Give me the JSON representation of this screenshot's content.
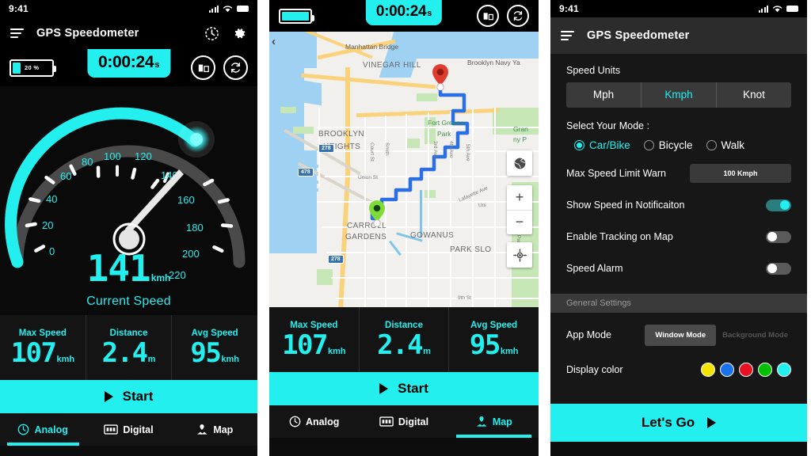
{
  "app": {
    "title": "GPS Speedometer",
    "accent": "#24efef",
    "background": "#0d0d0d"
  },
  "status_bar": {
    "time": "9:41"
  },
  "panel1": {
    "icons": {
      "menu": "hamburger-icon",
      "history": "history-clock-icon",
      "settings": "gear-icon"
    },
    "battery": {
      "percent": "20 %"
    },
    "timer": {
      "value": "0:00:24",
      "unit": "s"
    },
    "actions": {
      "split": "split-screen-icon",
      "reset": "refresh-icon"
    },
    "gauge": {
      "current_speed": "141",
      "unit": "kmh",
      "caption": "Current Speed",
      "ticks": [
        "0",
        "20",
        "40",
        "60",
        "80",
        "100",
        "120",
        "140",
        "160",
        "180",
        "200",
        "220"
      ]
    },
    "stats": [
      {
        "label": "Max Speed",
        "value": "107",
        "unit": "kmh"
      },
      {
        "label": "Distance",
        "value": "2.4",
        "unit": "m"
      },
      {
        "label": "Avg Speed",
        "value": "95",
        "unit": "kmh"
      }
    ],
    "start_button": "Start",
    "nav": [
      {
        "label": "Analog",
        "icon": "speedometer-icon",
        "active": true
      },
      {
        "label": "Digital",
        "icon": "digital-display-icon",
        "active": false
      },
      {
        "label": "Map",
        "icon": "map-pin-icon",
        "active": false
      }
    ]
  },
  "panel2": {
    "timer": {
      "value": "0:00:24",
      "unit": "s"
    },
    "actions": {
      "split": "split-screen-icon",
      "reset": "refresh-icon"
    },
    "map": {
      "labels": [
        "Manhattan Bridge",
        "VINEGAR HILL",
        "Brooklyn Navy Ya",
        "Fort Greene",
        "Park",
        "BROOKLYN",
        "HEIGHTS",
        "CARROLL",
        "GARDENS",
        "GOWANUS",
        "PARK SLO",
        "Union St",
        "Court St",
        "Smith",
        "3rd Ave",
        "4th Ave",
        "5th Ave",
        "9th St",
        "Lafayette Ave",
        "Gran",
        "ny P",
        "Uni",
        "ct Park West"
      ],
      "shields": [
        "278",
        "478",
        "278"
      ],
      "controls": {
        "globe": "globe-icon",
        "zoom_in": "+",
        "zoom_out": "−",
        "locate": "locate-crosshair-icon"
      },
      "markers": {
        "start": "green-pin",
        "end": "red-pin"
      }
    },
    "stats": [
      {
        "label": "Max Speed",
        "value": "107",
        "unit": "kmh"
      },
      {
        "label": "Distance",
        "value": "2.4",
        "unit": "m"
      },
      {
        "label": "Avg Speed",
        "value": "95",
        "unit": "kmh"
      }
    ],
    "start_button": "Start",
    "nav": [
      {
        "label": "Analog",
        "icon": "speedometer-icon",
        "active": false
      },
      {
        "label": "Digital",
        "icon": "digital-display-icon",
        "active": false
      },
      {
        "label": "Map",
        "icon": "map-pin-icon",
        "active": true
      }
    ]
  },
  "panel3": {
    "title": "GPS Speedometer",
    "speed_units": {
      "label": "Speed Units",
      "options": [
        "Mph",
        "Kmph",
        "Knot"
      ],
      "selected": "Kmph"
    },
    "mode": {
      "label": "Select Your Mode :",
      "options": [
        "Car/Bike",
        "Bicycle",
        "Walk"
      ],
      "selected": "Car/Bike"
    },
    "max_speed_warn": {
      "label": "Max Speed Limit Warn",
      "value": "100 Kmph"
    },
    "toggles": [
      {
        "label": "Show Speed in Notificaiton",
        "on": true
      },
      {
        "label": "Enable Tracking on Map",
        "on": false
      },
      {
        "label": "Speed Alarm",
        "on": false
      }
    ],
    "general_settings_header": "General Settings",
    "app_mode": {
      "label": "App Mode",
      "active": "Window Mode",
      "inactive": "Background Mode"
    },
    "display_color": {
      "label": "Display color",
      "swatches": [
        "#f5e400",
        "#1a73e8",
        "#e81123",
        "#00c000",
        "#24efef"
      ]
    },
    "cta": "Let's Go"
  }
}
